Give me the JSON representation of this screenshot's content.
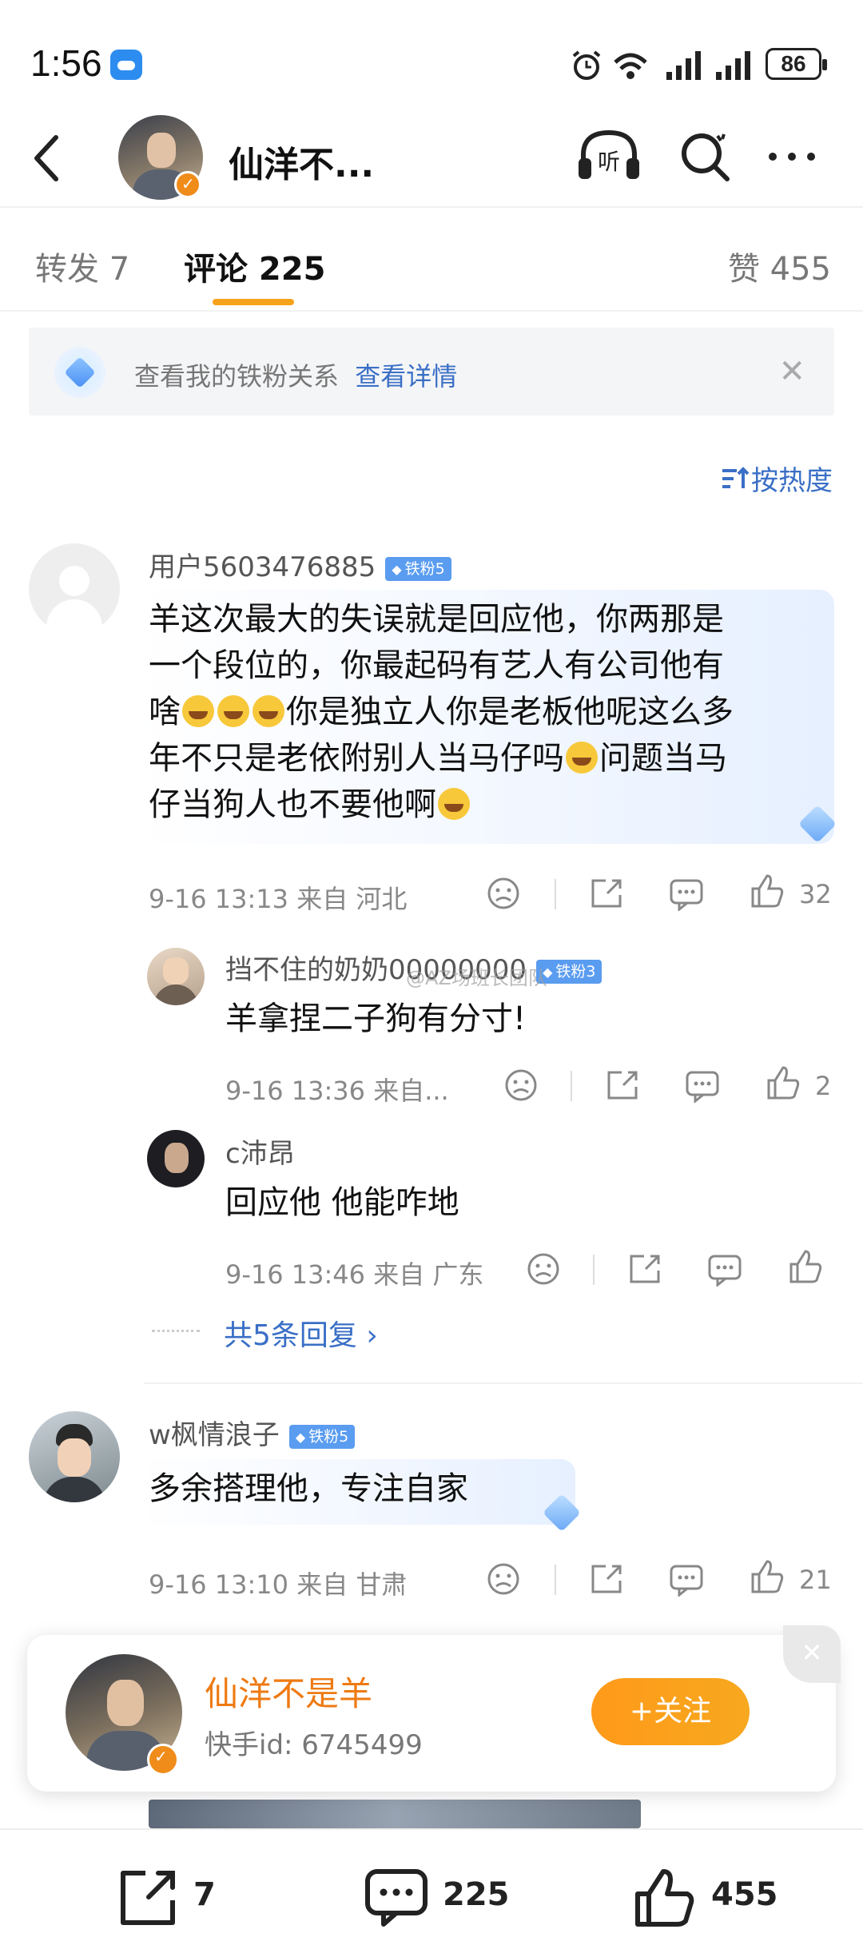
{
  "status_bar": {
    "time": "1:56",
    "battery": "86"
  },
  "header": {
    "title": "仙洋不...",
    "listen_label": "听"
  },
  "tabs": {
    "repost": "转发 7",
    "comments": "评论 225",
    "likes": "赞 455"
  },
  "fan_banner": {
    "text": "查看我的铁粉关系",
    "link": "查看详情"
  },
  "sort_label": "按热度",
  "comments": [
    {
      "user": "用户5603476885",
      "badge": "铁粉5",
      "text_lines": [
        "羊这次最大的失误就是回应他，你两那是",
        "一个段位的，你最起码有艺人有公司他有",
        "啥",
        "你是独立人你是老板他呢这么多",
        "年不只是老依附别人当马仔吗",
        "问题当马",
        "仔当狗人也不要他啊"
      ],
      "time": "9-16 13:13",
      "location": "来自 河北",
      "likes": "32",
      "replies": [
        {
          "user": "挡不住的奶奶00000000",
          "badge": "铁粉3",
          "text": "羊拿捏二子狗有分寸!",
          "time": "9-16 13:36",
          "location": "来自...",
          "likes": "2"
        },
        {
          "user": "c沛昂",
          "text": "回应他 他能咋地",
          "time": "9-16 13:46",
          "location": "来自 广东",
          "likes": ""
        }
      ],
      "more_replies": "共5条回复 ›"
    },
    {
      "user": "w枫情浪子",
      "badge": "铁粉5",
      "text": "多余搭理他，专注自家",
      "time": "9-16 13:10",
      "location": "来自 甘肃",
      "likes": "21"
    }
  ],
  "watermark": "@AZ场班长团队",
  "follow_card": {
    "name": "仙洋不是羊",
    "id": "快手id:  6745499",
    "button": "+关注"
  },
  "bottom_bar": {
    "repost_count": "7",
    "comment_count": "225",
    "like_count": "455"
  },
  "colors": {
    "accent": "#f7a21b",
    "link": "#3a6fc6",
    "follow": "#ff9a1a",
    "badge": "#5a9cf0"
  }
}
